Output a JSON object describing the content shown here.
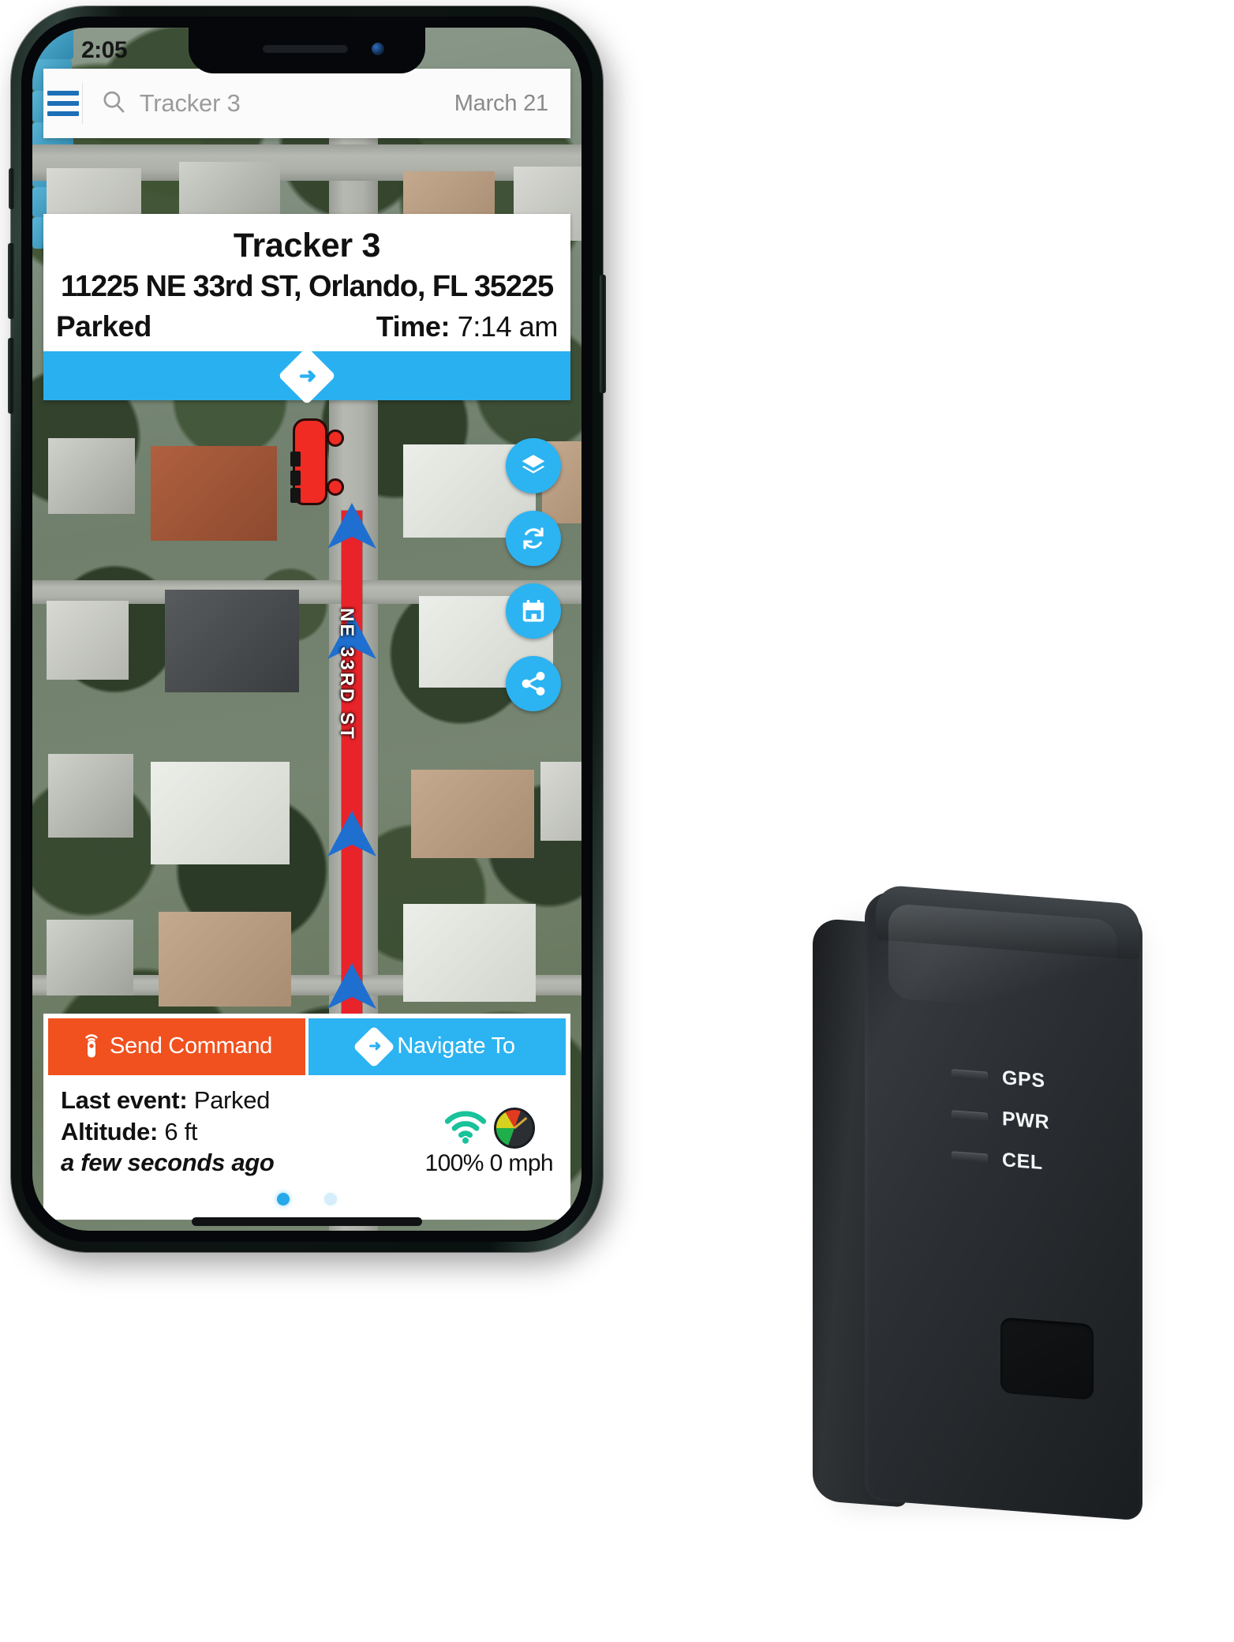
{
  "status_bar": {
    "time": "2:05"
  },
  "header": {
    "menu_icon": "hamburger-menu-icon",
    "search_icon": "search-icon",
    "search_value": "Tracker 3",
    "search_placeholder": "Tracker 3",
    "date": "March 21"
  },
  "map": {
    "badge_icon": "map-alert-badge-icon",
    "street_label": "NE 33RD ST",
    "vehicle_marker": "red-car-marker-icon",
    "route_arrow_icon": "route-direction-arrow-icon",
    "controls": [
      {
        "name": "map-layers-button",
        "icon": "layers-icon",
        "label": "Layers"
      },
      {
        "name": "map-refresh-button",
        "icon": "refresh-icon",
        "label": "Refresh"
      },
      {
        "name": "map-calendar-button",
        "icon": "calendar-icon",
        "label": "History"
      },
      {
        "name": "map-share-button",
        "icon": "share-icon",
        "label": "Share"
      }
    ]
  },
  "info_card": {
    "title": "Tracker 3",
    "address": "11225 NE 33rd ST, Orlando, FL 35225",
    "status": "Parked",
    "time_label": "Time:",
    "time_value": "7:14 am",
    "nav_bar_icon": "navigate-diamond-arrow-icon"
  },
  "bottom_panel": {
    "send_command": {
      "label": "Send Command",
      "icon": "remote-signal-icon",
      "color": "#f0511e"
    },
    "navigate_to": {
      "label": "Navigate To",
      "icon": "navigate-diamond-arrow-icon",
      "color": "#2cb3f2"
    },
    "last_event_label": "Last event:",
    "last_event_value": "Parked",
    "altitude_label": "Altitude:",
    "altitude_value": "6 ft",
    "relative_time": "a few seconds ago",
    "signal_icon": "wifi-signal-icon",
    "speed_icon": "speedometer-icon",
    "battery_percent": "100%",
    "speed": "0 mph",
    "page_dots": 2,
    "active_dot": 0
  },
  "device": {
    "led_labels": [
      "GPS",
      "PWR",
      "CEL"
    ]
  },
  "colors": {
    "accent_blue": "#2cb3f2",
    "accent_orange": "#f0511e",
    "route_red": "#e8232a",
    "arrow_blue": "#1f6fd0",
    "menu_blue": "#1d6fb8"
  }
}
